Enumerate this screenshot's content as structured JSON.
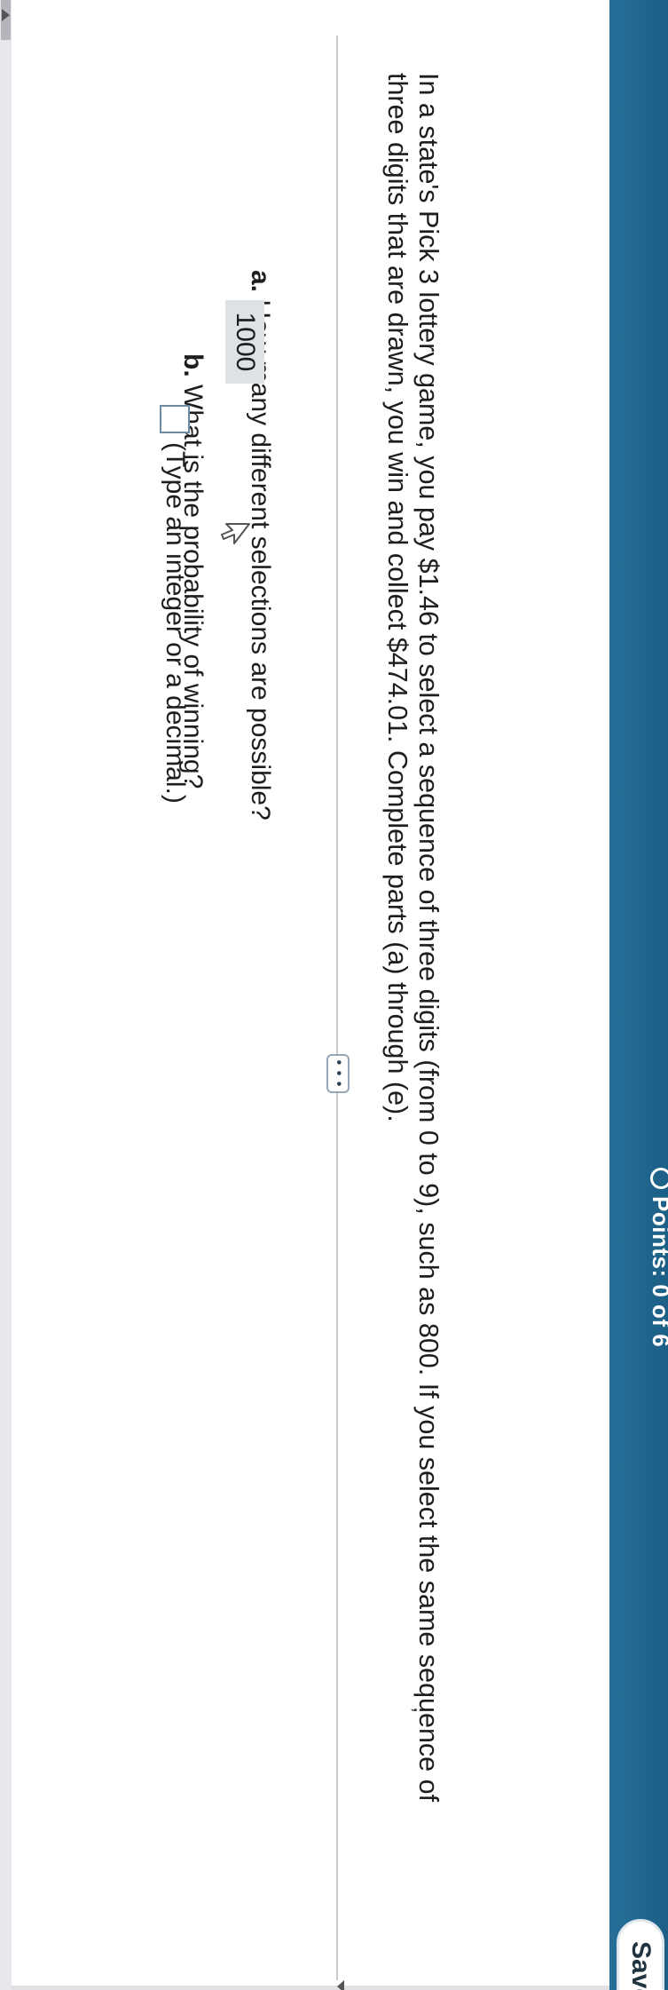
{
  "header": {
    "points_label": "Points: 0 of 6",
    "points_icon": "circle-icon",
    "save_label": "Save",
    "background_color": "#1c5f86"
  },
  "question": {
    "stem": "In a state's Pick 3 lottery game, you pay $1.46 to select a sequence of three digits (from 0 to 9), such as 800. If you select the same sequence of three digits that are drawn, you win and collect $474.01. Complete parts (a) through (e).",
    "more_label": "• • •"
  },
  "part_a": {
    "letter": "a.",
    "prompt": "How many different selections are possible?",
    "answer": "1000"
  },
  "part_b": {
    "letter": "b.",
    "prompt": "What is the probability of winning?",
    "answer": "",
    "hint": "(Type an integer or a decimal.)"
  },
  "stray_mark": ","
}
